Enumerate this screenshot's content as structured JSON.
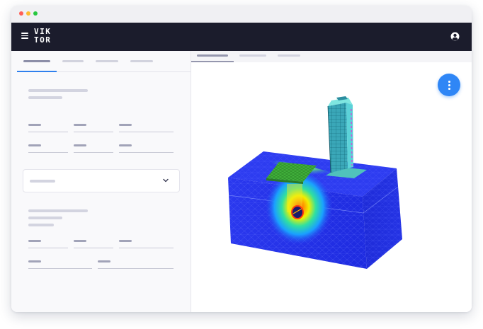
{
  "window": {
    "traffic_lights": [
      "#ff5f57",
      "#febc2e",
      "#28c840"
    ]
  },
  "appbar": {
    "logo_line1": "VIK",
    "logo_line2": "TOR",
    "menu_icon": "hamburger-icon",
    "account_icon": "user-circle-icon",
    "background": "#1b1c2c"
  },
  "left_panel": {
    "tab_count": 4,
    "active_tab_index": 0,
    "accent": "#2f80ed"
  },
  "right_panel": {
    "view_tab_count": 3,
    "active_view_tab_index": 0,
    "fab_icon": "more-vertical-icon",
    "fab_color": "#2f86f6",
    "scene": "3d-fem-model-tunnel-under-building"
  }
}
